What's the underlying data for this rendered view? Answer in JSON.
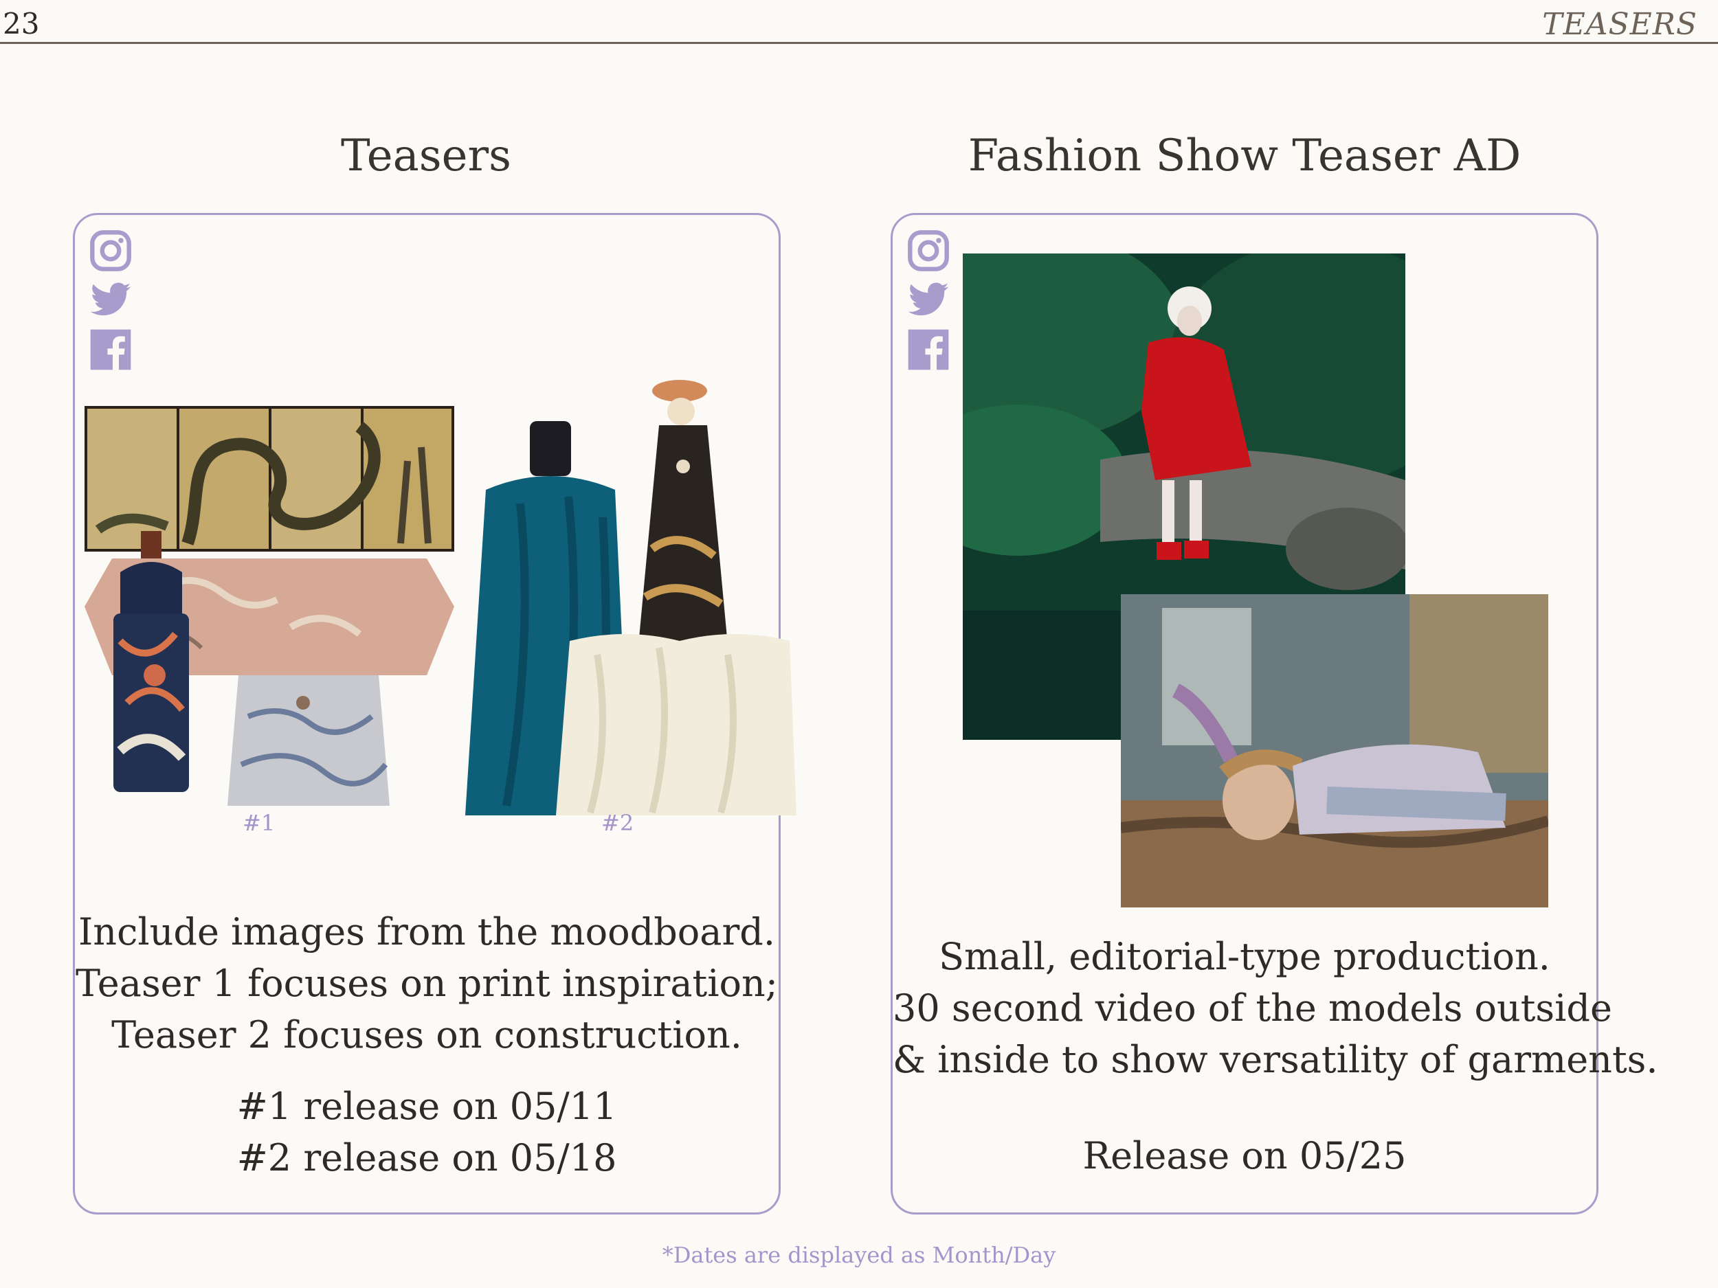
{
  "header": {
    "page_number": "23",
    "section": "TEASERS"
  },
  "left": {
    "title": "Teasers",
    "social_icons": [
      "instagram-icon",
      "twitter-icon",
      "facebook-icon"
    ],
    "captions": [
      "#1",
      "#2"
    ],
    "description": [
      "Include images from the moodboard.",
      "Teaser 1 focuses on print inspiration;",
      "Teaser 2 focuses on construction."
    ],
    "releases": [
      "#1 release on 05/11",
      "#2 release on 05/18"
    ]
  },
  "right": {
    "title": "Fashion Show Teaser AD",
    "social_icons": [
      "instagram-icon",
      "twitter-icon",
      "facebook-icon"
    ],
    "description": [
      "Small, editorial-type production.",
      "30 second video of the models outside",
      "& inside to show versatility of garments."
    ],
    "release": "Release on 05/25"
  },
  "footnote": "*Dates are displayed as Month/Day",
  "colors": {
    "accent": "#a89ccc",
    "text": "#2e2a26",
    "caption": "#a594cc"
  }
}
